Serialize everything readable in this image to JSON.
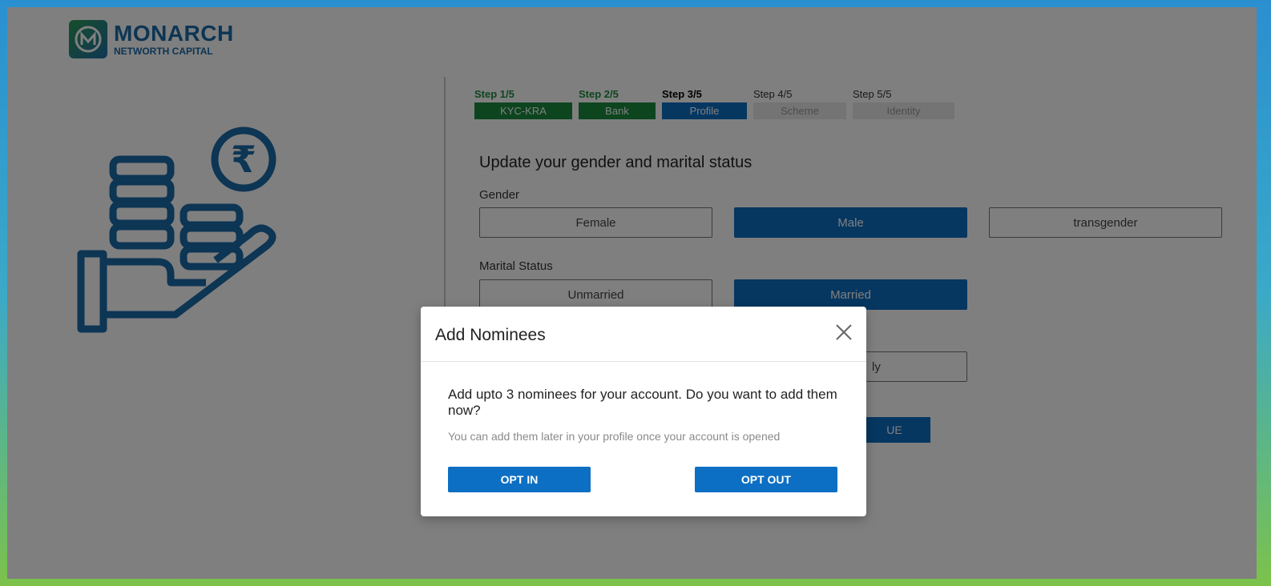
{
  "brand": {
    "name": "MONARCH",
    "sub": "NETWORTH CAPITAL"
  },
  "steps": [
    {
      "label": "Step 1/5",
      "name": "KYC-KRA",
      "status": "done"
    },
    {
      "label": "Step 2/5",
      "name": "Bank",
      "status": "done"
    },
    {
      "label": "Step 3/5",
      "name": "Profile",
      "status": "active"
    },
    {
      "label": "Step 4/5",
      "name": "Scheme",
      "status": "todo"
    },
    {
      "label": "Step 5/5",
      "name": "Identity",
      "status": "todo"
    }
  ],
  "form": {
    "heading": "Update your gender and marital status",
    "gender_label": "Gender",
    "gender_options": [
      "Female",
      "Male",
      "transgender"
    ],
    "gender_selected": "Male",
    "marital_label": "Marital Status",
    "marital_options": [
      "Unmarried",
      "Married"
    ],
    "marital_selected": "Married",
    "partial_option": "ly",
    "continue_partial": "UE"
  },
  "modal": {
    "title": "Add Nominees",
    "message": "Add upto 3 nominees for your account. Do you want to add them now?",
    "sub": "You can add them later in your profile once your account is opened",
    "opt_in": "OPT IN",
    "opt_out": "OPT OUT"
  },
  "colors": {
    "primary": "#0d6fc3",
    "done": "#1b8a3f",
    "brand": "#1a6aa8"
  }
}
